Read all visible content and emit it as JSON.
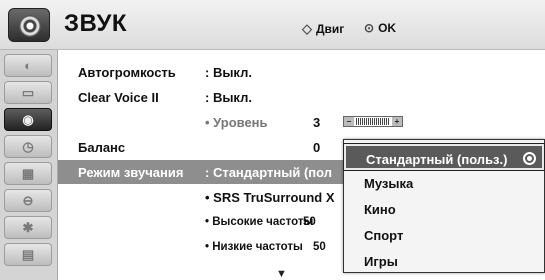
{
  "header": {
    "title": "ЗВУК",
    "nav_hint": "Двиг",
    "ok_hint": "OK",
    "icon": "speaker-icon"
  },
  "sidebar": {
    "items": [
      {
        "icon": "picture-icon"
      },
      {
        "icon": "screen-icon"
      },
      {
        "icon": "sound-icon"
      },
      {
        "icon": "clock-icon"
      },
      {
        "icon": "calendar-icon"
      },
      {
        "icon": "lock-icon"
      },
      {
        "icon": "option-icon"
      },
      {
        "icon": "media-icon"
      }
    ]
  },
  "settings": {
    "auto_volume": {
      "label": "Автогромкость",
      "value": ": Выкл."
    },
    "clear_voice": {
      "label": "Clear Voice II",
      "value": ": Выкл."
    },
    "level": {
      "label": "• Уровень",
      "value": "3"
    },
    "balance": {
      "label": "Баланс",
      "value": "0"
    },
    "sound_mode": {
      "label": "Режим звучания",
      "value": ": Стандартный (пол"
    },
    "srs": {
      "label": "• SRS TruSurround X"
    },
    "treble": {
      "label": "• Высокие частоты",
      "value": "50"
    },
    "bass": {
      "label": "• Низкие частоты",
      "value": "50"
    }
  },
  "sound_mode_popup": {
    "options": [
      "Стандартный (польз.)",
      "Музыка",
      "Кино",
      "Спорт",
      "Игры"
    ],
    "selected_index": 0
  },
  "colors": {
    "selected_row": "#8e8e8e",
    "popup_highlight": "#5a5a5a"
  }
}
